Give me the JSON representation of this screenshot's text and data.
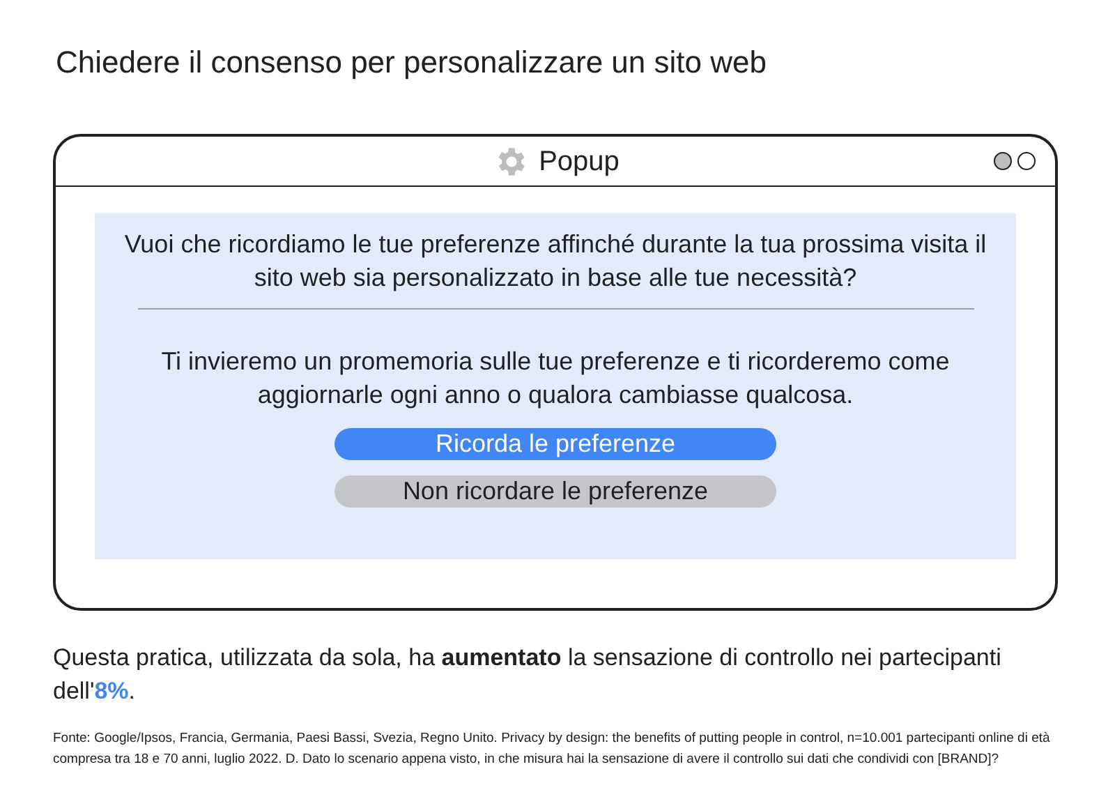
{
  "title": "Chiedere il consenso per personalizzare un sito web",
  "window": {
    "title": "Popup",
    "dots": [
      {
        "filled": true
      },
      {
        "filled": false
      }
    ]
  },
  "popup": {
    "question": "Vuoi che ricordiamo le tue preferenze affinché durante la tua prossima visita il sito web sia personalizzato in base alle tue necessità?",
    "body": "Ti invieremo un promemoria sulle tue preferenze e ti ricorderemo come aggiornarle ogni anno o qualora cambiasse qualcosa.",
    "buttons": [
      {
        "label": "Ricorda le preferenze",
        "kind": "primary"
      },
      {
        "label": "Non ricordare le preferenze",
        "kind": "secondary"
      }
    ]
  },
  "finding": "Questa pratica, utilizzata da sola, ha **aumentato** la sensazione di controllo nei partecipanti dell'",
  "finding_highlight": "8%",
  "finding_end": ".",
  "source": "Fonte: Google/Ipsos, Francia, Germania, Paesi Bassi, Svezia, Regno Unito. Privacy by design: the benefits of putting people in control, n=10.001 partecipanti online di età compresa tra 18 e 70 anni, luglio 2022. D. Dato lo scenario appena visto, in che misura hai la sensazione di avere il controllo sui dati che condividi con [BRAND]?"
}
